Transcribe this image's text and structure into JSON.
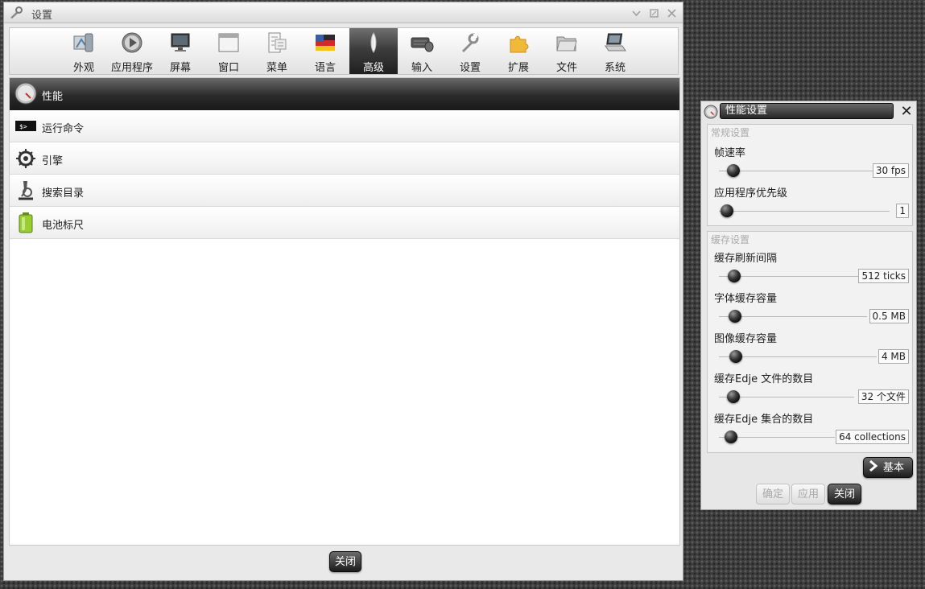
{
  "main_window": {
    "title": "设置",
    "toolbar": [
      {
        "label": "外观",
        "icon": "appearance-icon"
      },
      {
        "label": "应用程序",
        "icon": "applications-icon"
      },
      {
        "label": "屏幕",
        "icon": "screen-icon"
      },
      {
        "label": "窗口",
        "icon": "window-icon"
      },
      {
        "label": "菜单",
        "icon": "menu-icon"
      },
      {
        "label": "语言",
        "icon": "language-icon"
      },
      {
        "label": "高级",
        "icon": "advanced-icon",
        "active": true
      },
      {
        "label": "输入",
        "icon": "input-icon"
      },
      {
        "label": "设置",
        "icon": "settings-icon"
      },
      {
        "label": "扩展",
        "icon": "extensions-icon"
      },
      {
        "label": "文件",
        "icon": "files-icon"
      },
      {
        "label": "系统",
        "icon": "system-icon"
      }
    ],
    "list": [
      {
        "label": "性能",
        "icon": "gauge-icon",
        "selected": true
      },
      {
        "label": "运行命令",
        "icon": "terminal-icon"
      },
      {
        "label": "引擎",
        "icon": "engine-icon"
      },
      {
        "label": "搜索目录",
        "icon": "microscope-icon"
      },
      {
        "label": "电池标尺",
        "icon": "battery-icon"
      }
    ],
    "close_label": "关闭"
  },
  "dialog": {
    "title": "性能设置",
    "general": {
      "title": "常规设置",
      "sliders": [
        {
          "label": "帧速率",
          "value": "30 fps",
          "level": 0.1
        },
        {
          "label": "应用程序优先级",
          "value": "1",
          "level": 0.0
        }
      ]
    },
    "cache": {
      "title": "缓存设置",
      "sliders": [
        {
          "label": "缓存刷新间隔",
          "value": "512 ticks",
          "level": 0.1
        },
        {
          "label": "字体缓存容量",
          "value": "0.5 MB",
          "level": 0.1
        },
        {
          "label": "图像缓存容量",
          "value": "4 MB",
          "level": 0.1
        },
        {
          "label": "缓存Edje 文件的数目",
          "value": "32 个文件",
          "level": 0.1
        },
        {
          "label": "缓存Edje 集合的数目",
          "value": "64 collections",
          "level": 0.1
        }
      ]
    },
    "basic_label": "基本",
    "ok_label": "确定",
    "apply_label": "应用",
    "close_label": "关闭"
  },
  "colors": {
    "accent_dark": "#1c1c1c",
    "selected_text": "#ffffff",
    "disabled_text": "#a8a8a8"
  }
}
